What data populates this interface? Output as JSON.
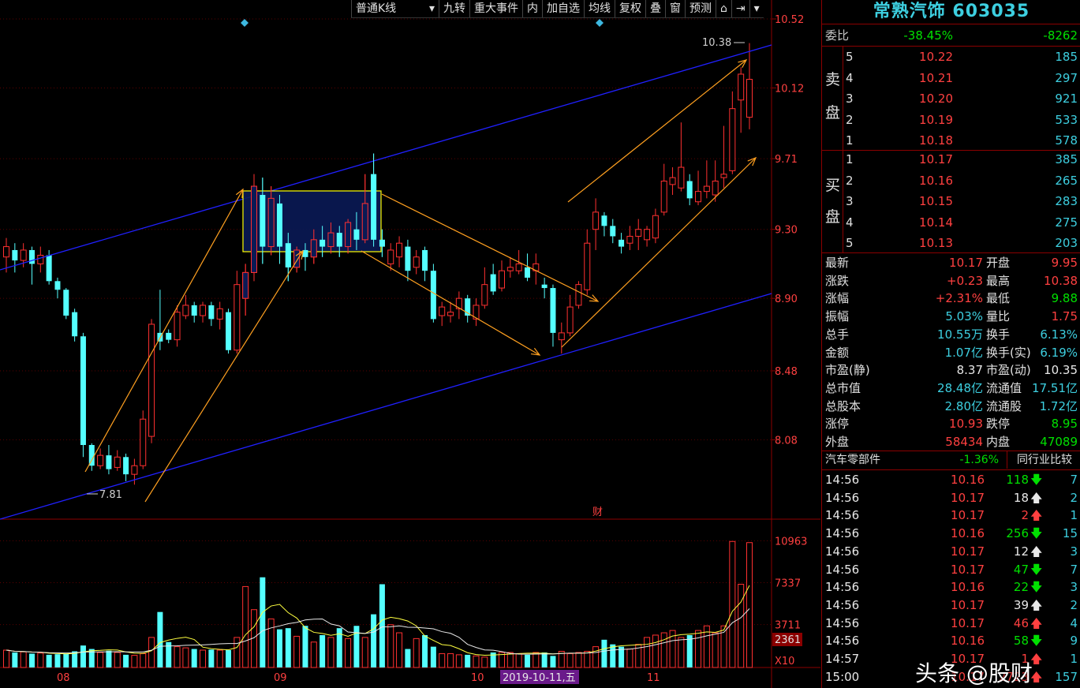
{
  "toolbar": {
    "items": [
      "普通K线",
      "九转",
      "重大事件",
      "内",
      "加自选",
      "均线",
      "复权",
      "叠",
      "窗",
      "预测"
    ],
    "lock_icon": "lock-icon",
    "arrow_icon": "arrow-right-icon",
    "menu_icon": "chevron-down-icon"
  },
  "chart_data": {
    "type": "candlestick",
    "y_ticks": [
      "10.52",
      "10.12",
      "9.71",
      "9.30",
      "8.90",
      "8.48",
      "8.08"
    ],
    "ylim": [
      7.62,
      10.52
    ],
    "x_labels": [
      "08",
      "09",
      "10",
      "11"
    ],
    "date_badge": "2019-10-11,五",
    "high_marker": "10.38",
    "low_marker": "7.81",
    "event_badge": "财",
    "volume_ticks": [
      "10963",
      "7337",
      "3711"
    ],
    "volume_current": "2361",
    "volume_unit": "X10",
    "candles": [
      [
        9.14,
        9.2,
        9.25,
        9.05
      ],
      [
        9.18,
        9.12,
        9.22,
        9.05
      ],
      [
        9.12,
        9.18,
        9.22,
        9.08
      ],
      [
        9.18,
        9.1,
        9.2,
        8.98
      ],
      [
        9.1,
        9.15,
        9.2,
        9.05
      ],
      [
        9.15,
        9.0,
        9.18,
        8.98
      ],
      [
        9.0,
        8.95,
        9.02,
        8.9
      ],
      [
        8.95,
        8.8,
        8.96,
        8.78
      ],
      [
        8.82,
        8.68,
        8.84,
        8.65
      ],
      [
        8.68,
        8.05,
        8.7,
        7.98
      ],
      [
        8.05,
        7.93,
        8.06,
        7.9
      ],
      [
        7.93,
        7.99,
        8.03,
        7.91
      ],
      [
        7.99,
        7.91,
        8.05,
        7.88
      ],
      [
        7.92,
        7.98,
        8.02,
        7.9
      ],
      [
        7.98,
        7.88,
        8.0,
        7.84
      ],
      [
        7.88,
        7.93,
        7.97,
        7.82
      ],
      [
        7.93,
        8.2,
        8.25,
        7.91
      ],
      [
        8.1,
        8.75,
        8.78,
        8.06
      ],
      [
        8.7,
        8.65,
        8.95,
        8.6
      ],
      [
        8.7,
        8.66,
        8.72,
        8.64
      ],
      [
        8.66,
        8.82,
        8.86,
        8.62
      ],
      [
        8.8,
        8.86,
        8.92,
        8.78
      ],
      [
        8.86,
        8.8,
        8.88,
        8.76
      ],
      [
        8.8,
        8.86,
        8.88,
        8.76
      ],
      [
        8.86,
        8.78,
        8.88,
        8.74
      ],
      [
        8.78,
        8.84,
        8.88,
        8.72
      ],
      [
        8.82,
        8.6,
        8.84,
        8.58
      ],
      [
        8.6,
        8.98,
        9.06,
        8.58
      ],
      [
        8.9,
        9.05,
        9.1,
        8.8
      ],
      [
        9.05,
        9.55,
        9.62,
        9.0
      ],
      [
        9.5,
        9.2,
        9.6,
        9.1
      ],
      [
        9.2,
        9.48,
        9.55,
        9.15
      ],
      [
        9.45,
        9.2,
        9.5,
        9.1
      ],
      [
        9.22,
        9.08,
        9.28,
        9.0
      ],
      [
        9.08,
        9.18,
        9.2,
        9.05
      ],
      [
        9.18,
        9.14,
        9.22,
        9.06
      ],
      [
        9.14,
        9.24,
        9.3,
        9.1
      ],
      [
        9.24,
        9.2,
        9.32,
        9.14
      ],
      [
        9.2,
        9.28,
        9.34,
        9.16
      ],
      [
        9.28,
        9.2,
        9.32,
        9.14
      ],
      [
        9.2,
        9.34,
        9.36,
        9.16
      ],
      [
        9.3,
        9.24,
        9.4,
        9.18
      ],
      [
        9.24,
        9.45,
        9.62,
        9.22
      ],
      [
        9.62,
        9.24,
        9.74,
        9.2
      ],
      [
        9.24,
        9.2,
        9.3,
        9.14
      ],
      [
        9.1,
        9.18,
        9.22,
        9.06
      ],
      [
        9.14,
        9.22,
        9.26,
        9.08
      ],
      [
        9.2,
        9.06,
        9.24,
        9.0
      ],
      [
        9.08,
        9.14,
        9.18,
        9.04
      ],
      [
        9.18,
        9.06,
        9.2,
        9.0
      ],
      [
        9.06,
        8.78,
        9.1,
        8.76
      ],
      [
        8.8,
        8.85,
        8.88,
        8.74
      ],
      [
        8.8,
        8.82,
        8.88,
        8.76
      ],
      [
        8.84,
        8.9,
        8.94,
        8.78
      ],
      [
        8.9,
        8.8,
        8.92,
        8.76
      ],
      [
        8.78,
        8.86,
        8.9,
        8.74
      ],
      [
        8.86,
        8.98,
        9.08,
        8.84
      ],
      [
        9.04,
        8.94,
        9.1,
        8.92
      ],
      [
        8.96,
        9.06,
        9.12,
        8.94
      ],
      [
        9.06,
        9.08,
        9.14,
        9.02
      ],
      [
        9.06,
        9.1,
        9.18,
        9.04
      ],
      [
        9.08,
        9.02,
        9.16,
        9.0
      ],
      [
        9.06,
        9.1,
        9.16,
        8.98
      ],
      [
        8.98,
        8.96,
        9.02,
        8.9
      ],
      [
        8.96,
        8.7,
        8.98,
        8.62
      ],
      [
        8.66,
        8.7,
        8.76,
        8.58
      ],
      [
        8.7,
        8.85,
        8.92,
        8.68
      ],
      [
        8.86,
        8.98,
        9.0,
        8.84
      ],
      [
        8.95,
        9.22,
        9.3,
        8.92
      ],
      [
        9.3,
        9.4,
        9.48,
        9.18
      ],
      [
        9.38,
        9.32,
        9.4,
        9.26
      ],
      [
        9.32,
        9.26,
        9.36,
        9.22
      ],
      [
        9.24,
        9.2,
        9.28,
        9.16
      ],
      [
        9.22,
        9.26,
        9.32,
        9.18
      ],
      [
        9.26,
        9.3,
        9.36,
        9.18
      ],
      [
        9.24,
        9.3,
        9.32,
        9.2
      ],
      [
        9.25,
        9.38,
        9.42,
        9.22
      ],
      [
        9.4,
        9.58,
        9.68,
        9.38
      ],
      [
        9.56,
        9.6,
        9.66,
        9.5
      ],
      [
        9.54,
        9.66,
        9.92,
        9.52
      ],
      [
        9.58,
        9.48,
        9.62,
        9.44
      ],
      [
        9.46,
        9.52,
        9.64,
        9.44
      ],
      [
        9.52,
        9.55,
        9.7,
        9.48
      ],
      [
        9.5,
        9.58,
        9.7,
        9.46
      ],
      [
        9.6,
        9.62,
        9.9,
        9.54
      ],
      [
        9.64,
        10.0,
        10.1,
        9.62
      ],
      [
        10.05,
        10.2,
        10.24,
        9.86
      ],
      [
        9.95,
        10.17,
        10.38,
        9.88
      ]
    ],
    "volumes": [
      1500,
      1300,
      1350,
      1200,
      1250,
      1100,
      1150,
      1200,
      1400,
      1900,
      1600,
      1300,
      1450,
      1300,
      1100,
      1050,
      1200,
      2600,
      4800,
      2200,
      1800,
      1700,
      1600,
      1500,
      1550,
      1500,
      1500,
      2600,
      7000,
      5000,
      7800,
      4200,
      3300,
      3400,
      2700,
      3600,
      2200,
      2800,
      2600,
      3400,
      2500,
      3600,
      2600,
      4600,
      7200,
      3700,
      3000,
      1600,
      2500,
      2800,
      1800,
      1200,
      1200,
      1100,
      1100,
      1000,
      900,
      1300,
      1300,
      1300,
      1200,
      1100,
      1300,
      1300,
      1000,
      1400,
      1200,
      1300,
      1400,
      1800,
      2400,
      2000,
      1800,
      1600,
      2000,
      2600,
      2800,
      3000,
      3200,
      2600,
      2800,
      3200,
      3600,
      3000,
      3600,
      10900,
      7200,
      10800
    ]
  },
  "panel": {
    "title": "常熟汽饰 603035",
    "weibi_label": "委比",
    "weibi_pct": "-38.45%",
    "weibi_val": "-8262",
    "sell_label": [
      "卖",
      "盘"
    ],
    "buy_label": [
      "买",
      "盘"
    ],
    "sells": [
      {
        "n": "5",
        "p": "10.22",
        "v": "185"
      },
      {
        "n": "4",
        "p": "10.21",
        "v": "297"
      },
      {
        "n": "3",
        "p": "10.20",
        "v": "921"
      },
      {
        "n": "2",
        "p": "10.19",
        "v": "533"
      },
      {
        "n": "1",
        "p": "10.18",
        "v": "578"
      }
    ],
    "buys": [
      {
        "n": "1",
        "p": "10.17",
        "v": "385"
      },
      {
        "n": "2",
        "p": "10.16",
        "v": "265"
      },
      {
        "n": "3",
        "p": "10.15",
        "v": "283"
      },
      {
        "n": "4",
        "p": "10.14",
        "v": "275"
      },
      {
        "n": "5",
        "p": "10.13",
        "v": "203"
      }
    ],
    "stats": [
      {
        "l1": "最新",
        "v1": "10.17",
        "c1": "red",
        "l2": "开盘",
        "v2": "9.95",
        "c2": "red"
      },
      {
        "l1": "涨跌",
        "v1": "+0.23",
        "c1": "red",
        "l2": "最高",
        "v2": "10.38",
        "c2": "red"
      },
      {
        "l1": "涨幅",
        "v1": "+2.31%",
        "c1": "red",
        "l2": "最低",
        "v2": "9.88",
        "c2": "green"
      },
      {
        "l1": "振幅",
        "v1": "5.03%",
        "c1": "cyan",
        "l2": "量比",
        "v2": "1.75",
        "c2": "red"
      },
      {
        "l1": "总手",
        "v1": "10.55万",
        "c1": "cyan",
        "l2": "换手",
        "v2": "6.13%",
        "c2": "cyan"
      },
      {
        "l1": "金额",
        "v1": "1.07亿",
        "c1": "cyan",
        "l2": "换手(实)",
        "v2": "6.19%",
        "c2": "cyan"
      },
      {
        "l1": "市盈(静)",
        "v1": "8.37",
        "c1": "white",
        "l2": "市盈(动)",
        "v2": "10.35",
        "c2": "white"
      },
      {
        "l1": "总市值",
        "v1": "28.48亿",
        "c1": "cyan",
        "l2": "流通值",
        "v2": "17.51亿",
        "c2": "cyan"
      },
      {
        "l1": "总股本",
        "v1": "2.80亿",
        "c1": "cyan",
        "l2": "流通股",
        "v2": "1.72亿",
        "c2": "cyan"
      },
      {
        "l1": "涨停",
        "v1": "10.93",
        "c1": "red",
        "l2": "跌停",
        "v2": "8.95",
        "c2": "green"
      },
      {
        "l1": "外盘",
        "v1": "58434",
        "c1": "red",
        "l2": "内盘",
        "v2": "47089",
        "c2": "green"
      }
    ],
    "sector_name": "汽车零部件",
    "sector_pct": "-1.36%",
    "sector_btn": "同行业比较",
    "ticks": [
      {
        "t": "14:56",
        "p": "10.16",
        "v": "118",
        "d": "down",
        "n": "7"
      },
      {
        "t": "14:56",
        "p": "10.17",
        "v": "18",
        "d": "up-w",
        "n": "2"
      },
      {
        "t": "14:56",
        "p": "10.17",
        "v": "2",
        "d": "up",
        "n": "1"
      },
      {
        "t": "14:56",
        "p": "10.16",
        "v": "256",
        "d": "down",
        "n": "15"
      },
      {
        "t": "14:56",
        "p": "10.17",
        "v": "12",
        "d": "up-w",
        "n": "3"
      },
      {
        "t": "14:56",
        "p": "10.17",
        "v": "47",
        "d": "down",
        "n": "7"
      },
      {
        "t": "14:56",
        "p": "10.16",
        "v": "22",
        "d": "down",
        "n": "3"
      },
      {
        "t": "14:56",
        "p": "10.17",
        "v": "39",
        "d": "up-w",
        "n": "2"
      },
      {
        "t": "14:56",
        "p": "10.17",
        "v": "46",
        "d": "up",
        "n": "4"
      },
      {
        "t": "14:56",
        "p": "10.16",
        "v": "58",
        "d": "down",
        "n": "9"
      },
      {
        "t": "14:57",
        "p": "10.17",
        "v": "1",
        "d": "up",
        "n": "1"
      },
      {
        "t": "15:00",
        "p": "10.17",
        "v": "2723",
        "d": "up",
        "n": "157"
      }
    ],
    "watermark": "头条 @股财"
  }
}
